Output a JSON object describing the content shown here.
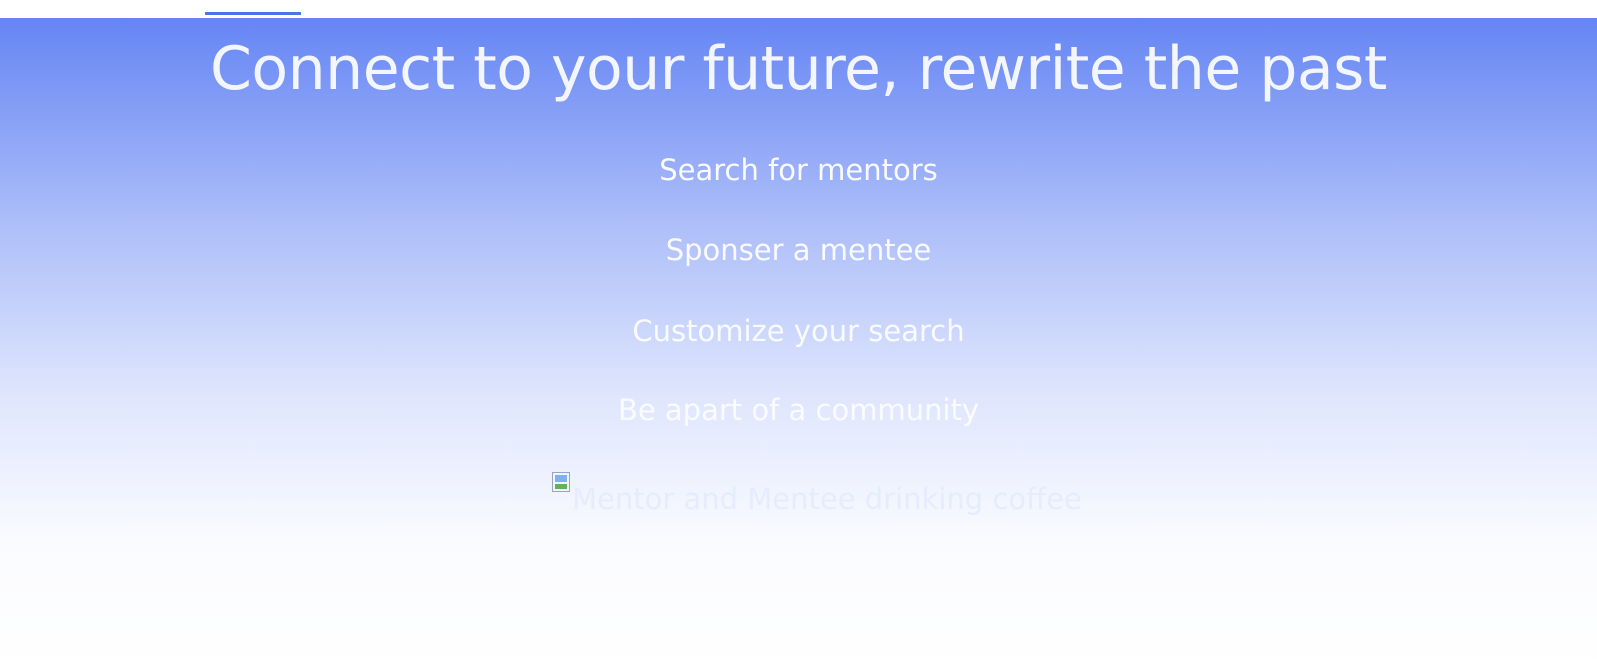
{
  "hero": {
    "title": "Connect to your future, rewrite the past",
    "features": [
      "Search for mentors",
      "Sponser a mentee",
      "Customize your search",
      "Be apart of a community"
    ],
    "image": {
      "alt": "Mentor and Mentee drinking coffee",
      "icon": "broken-image-icon"
    }
  },
  "colors": {
    "nav_active": "#4a74e8",
    "hero_gradient_top": "#6585f4",
    "hero_gradient_bottom": "#ffffff",
    "hero_text": "#f4f6fe"
  }
}
